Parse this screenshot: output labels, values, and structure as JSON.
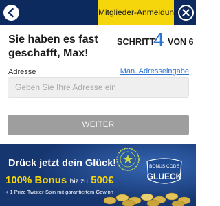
{
  "header": {
    "back_icon": "chevron-left-icon",
    "login_tab_label": "Mitglieder-Anmeldung",
    "close_icon": "close-icon",
    "colors": {
      "bar": "#0c2a5e",
      "tab": "#f5d50b"
    }
  },
  "main": {
    "headline": "Sie haben es fast geschafft, Max!",
    "step": {
      "word": "SCHRITT",
      "current": "4",
      "of_text": "VON 6"
    },
    "address": {
      "label": "Adresse",
      "manual_link": "Man. Adresseingabe",
      "value": "",
      "placeholder": "Geben Sie Ihre Adresse ein"
    },
    "submit_label": "WEITER"
  },
  "banner": {
    "headline": "Drück jetzt dein Glück!",
    "bonus_percent": "100% Bonus",
    "bonus_mid": "biz zu",
    "bonus_amount": "500€",
    "spin_text": "+ 1 Prize Twister-Spin mit garantiertem Gewinn",
    "bonus_code_label": "BONUS CODE",
    "bonus_code": "GLUECK",
    "colors": {
      "background": "#1a3d7c",
      "accent": "#f5d50b"
    }
  }
}
